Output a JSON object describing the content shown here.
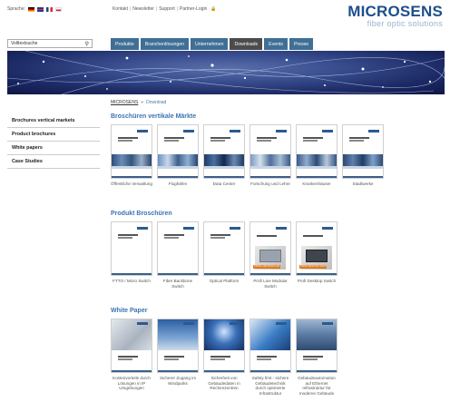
{
  "header": {
    "language_label": "Sprache:",
    "top_links": [
      "Kontakt",
      "Newsletter",
      "Support",
      "Partner-Login"
    ],
    "logo_main": "MICROSENS",
    "logo_sub": "fiber optic solutions"
  },
  "search": {
    "value": "Volltextsuche"
  },
  "nav": {
    "items": [
      {
        "label": "Produkte"
      },
      {
        "label": "Branchenlösungen"
      },
      {
        "label": "Unternehmen"
      },
      {
        "label": "Downloads"
      },
      {
        "label": "Events"
      },
      {
        "label": "Presse"
      }
    ],
    "active_index": 3
  },
  "breadcrumb": {
    "home": "MICROSENS",
    "separator": "»",
    "current": "Download"
  },
  "sidebar": {
    "items": [
      {
        "label": "Brochures vertical markets"
      },
      {
        "label": "Product brochures"
      },
      {
        "label": "White papers"
      },
      {
        "label": "Case Studies"
      }
    ]
  },
  "sections": [
    {
      "title": "Broschüren vertikale Märkte",
      "items": [
        {
          "caption": "Öffentliche Verwaltung"
        },
        {
          "caption": "Flughäfen"
        },
        {
          "caption": "Data Center"
        },
        {
          "caption": "Forschung und Lehre"
        },
        {
          "caption": "Krankenhäuser"
        },
        {
          "caption": "Stadtwerke"
        }
      ]
    },
    {
      "title": "Produkt Broschüren",
      "items": [
        {
          "caption": "FTTO / Micro Switch"
        },
        {
          "caption": "Fiber Backbone Switch"
        },
        {
          "caption": "Optical Platform"
        },
        {
          "caption": "Profi Line Modular Switch",
          "badge": "PROFI LINE MODULAR"
        },
        {
          "caption": "Profi Desktop Switch",
          "badge": "PROFI DESKTOP SWITCH"
        }
      ]
    },
    {
      "title": "White Paper",
      "items": [
        {
          "caption": "Kostenvorteile durch Lösungen in IP Umgebungen"
        },
        {
          "caption": "Sicherer Zugang im Windparks"
        },
        {
          "caption": "Sicherheit von Gebäudedaten in Rechenzentren"
        },
        {
          "caption": "Safety first - sichere Gebäudetechnik durch optimierte Infrastruktur"
        },
        {
          "caption": "Gebäudeautomation auf Ethernet Infrastruktur für moderne Gebäude"
        }
      ]
    }
  ],
  "colors": {
    "nav": "#3f6f95",
    "nav_active": "#4c4c4c",
    "section_title": "#3a74b4",
    "logo": "#1e4e8c"
  }
}
